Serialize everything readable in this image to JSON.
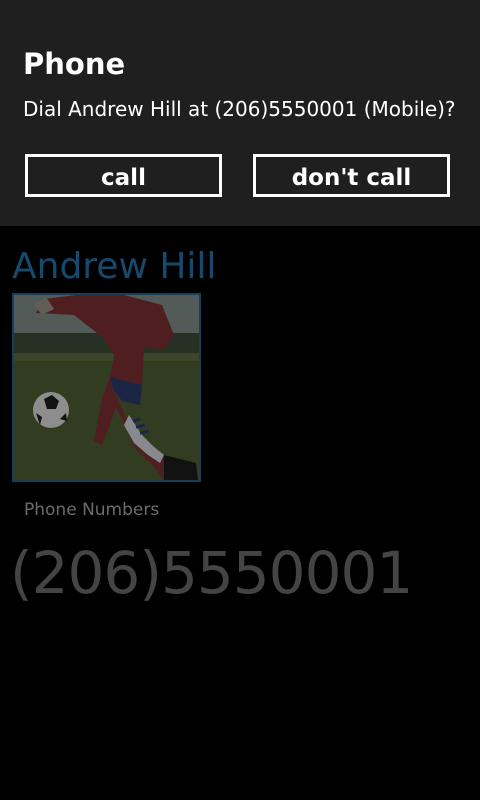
{
  "dialog": {
    "title": "Phone",
    "message": "Dial Andrew Hill at (206)5550001 (Mobile)?",
    "call_label": "call",
    "dont_call_label": "don't call"
  },
  "contact": {
    "name": "Andrew Hill",
    "photo_alt": "contact photo",
    "phone_numbers_heading": "Phone Numbers",
    "phone_number": "(206)5550001"
  },
  "colors": {
    "dialog_background": "#1f1f1f",
    "page_background": "#000000",
    "contact_name": "#164a6c",
    "phone_number": "#444444",
    "section_label": "#6c6c6c"
  }
}
